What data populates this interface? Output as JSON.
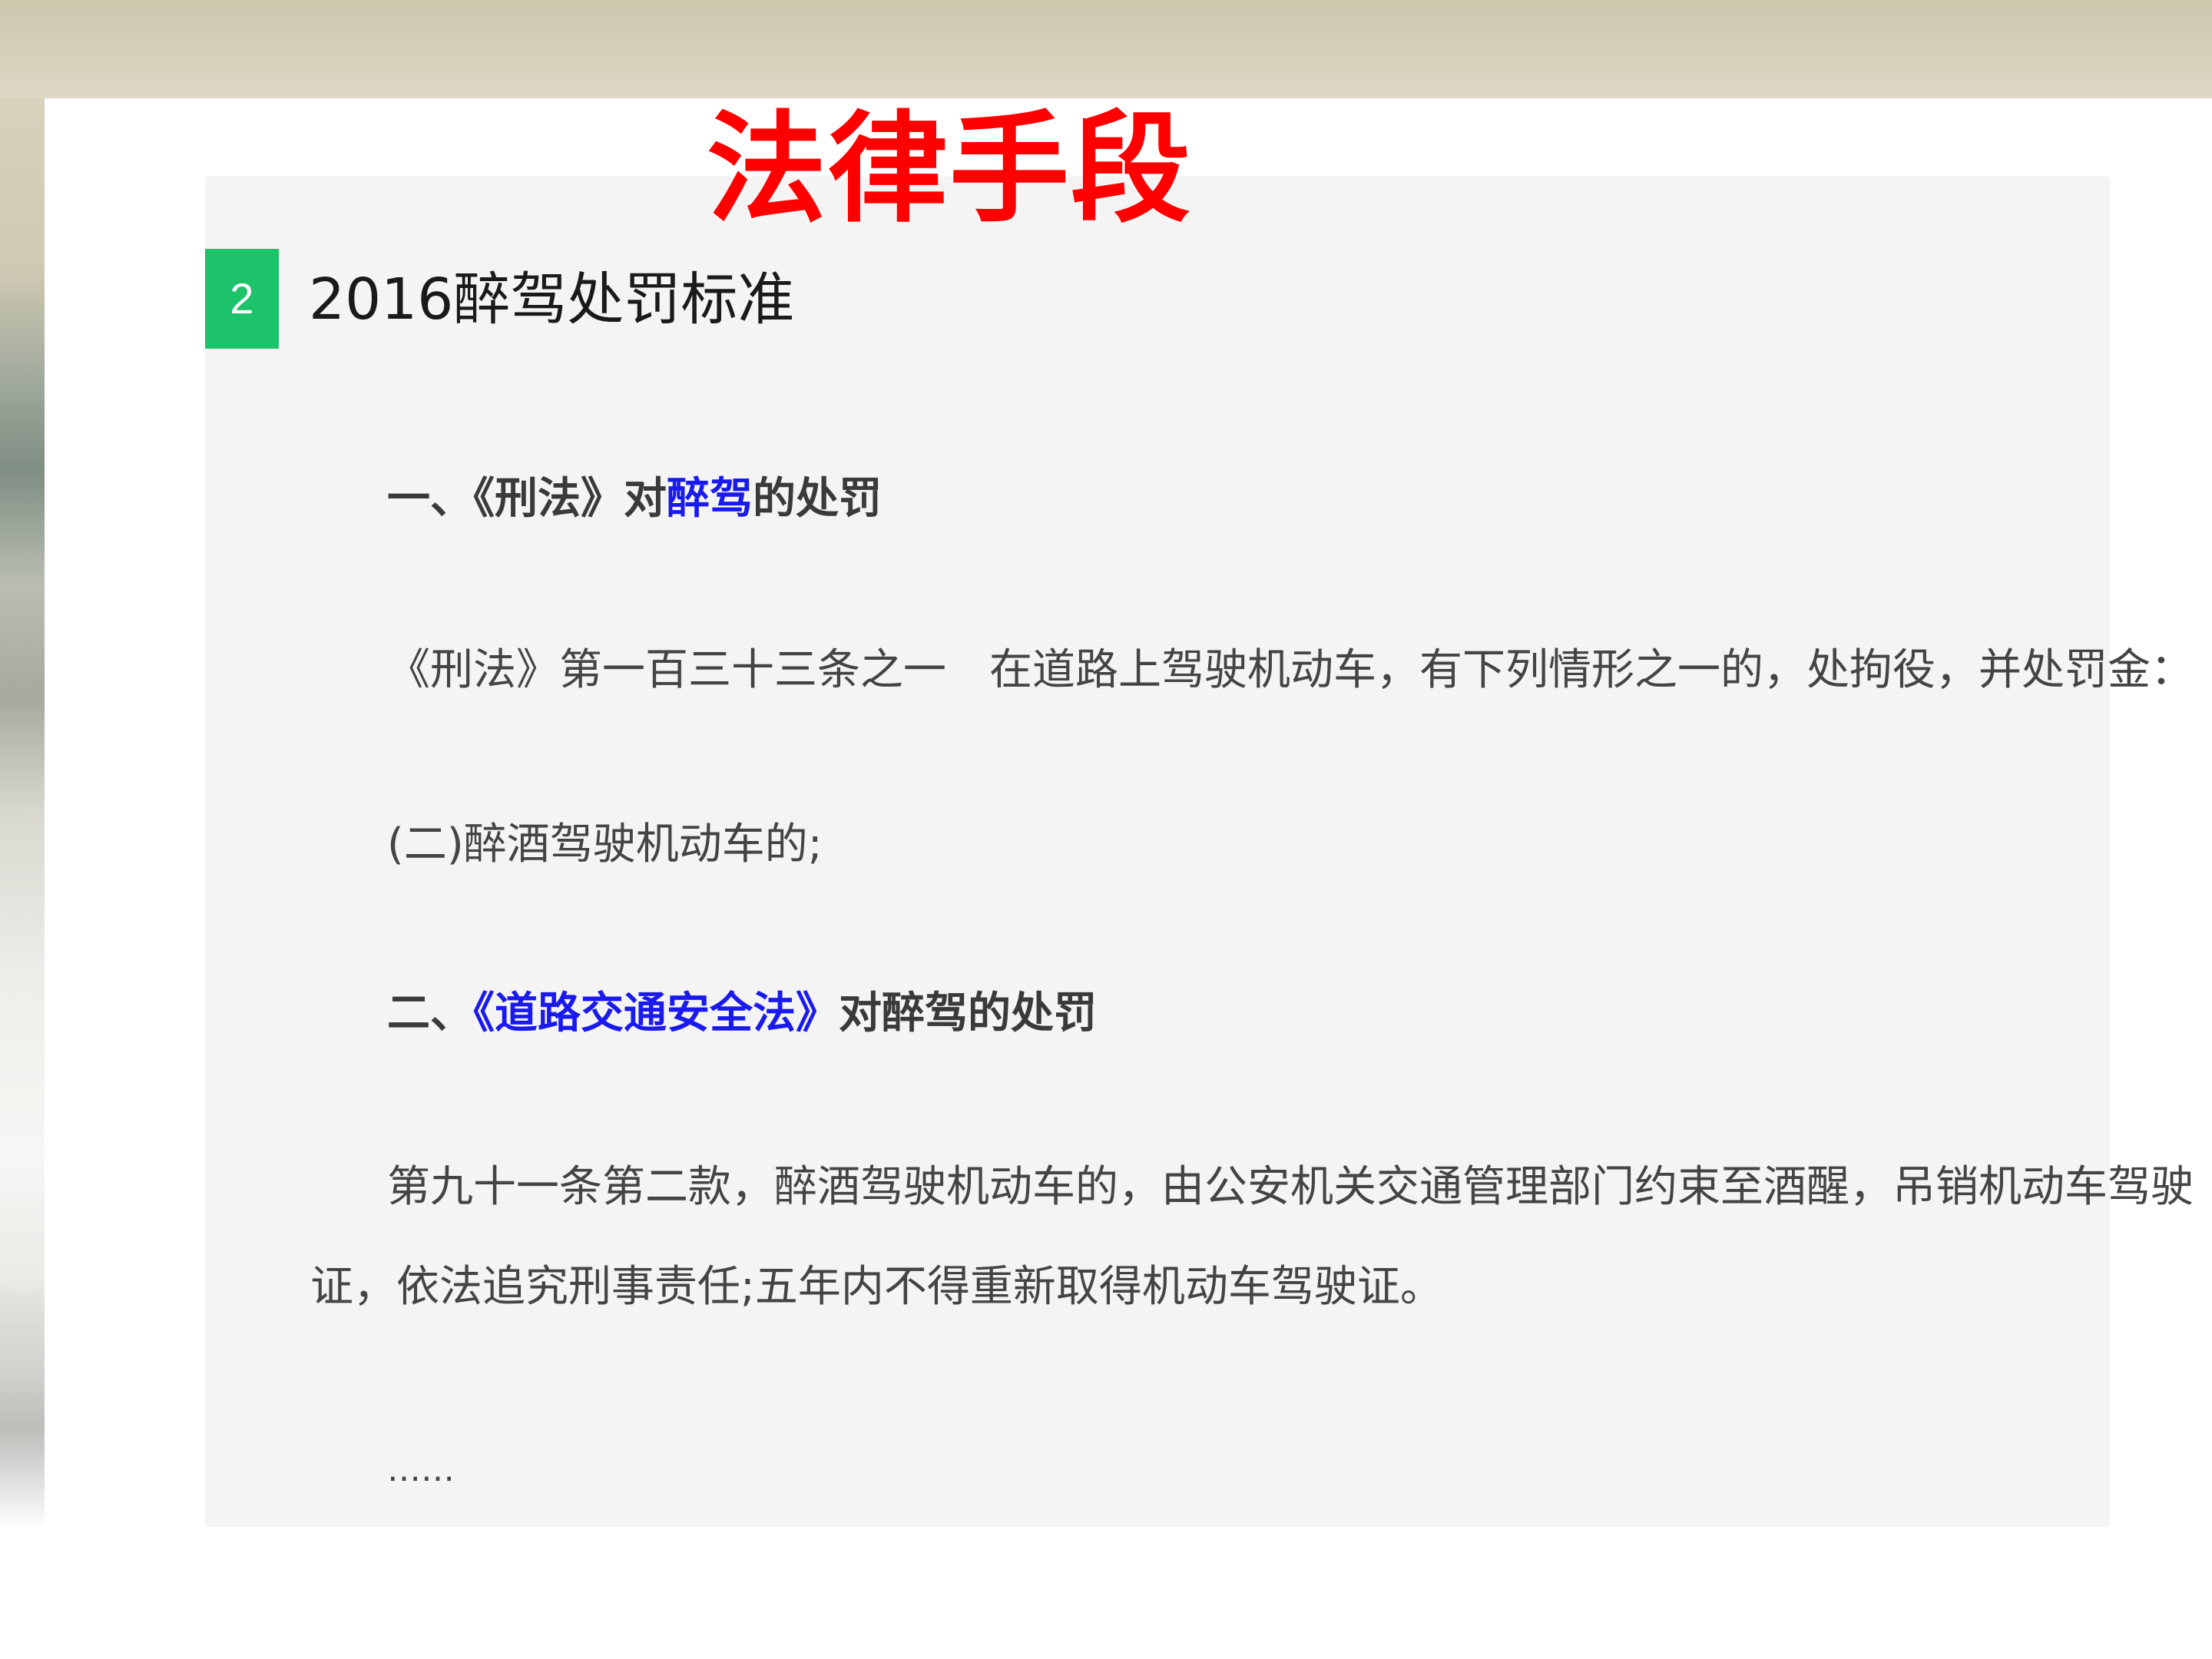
{
  "slide": {
    "title": "法律手段"
  },
  "article": {
    "step_number": "2",
    "step_heading": "2016醉驾处罚标准",
    "section1": {
      "prefix": "一、《刑法》对",
      "link": "醉驾",
      "suffix": "的处罚"
    },
    "para1": "《刑法》第一百三十三条之一　在道路上驾驶机动车，有下列情形之一的，处拘役，并处罚金：",
    "para2": "(二)醉酒驾驶机动车的;",
    "section2": {
      "prefix": "二、",
      "link": "《道路交通安全法》",
      "suffix": "对醉驾的处罚"
    },
    "para3_line1": "第九十一条第二款，醉酒驾驶机动车的，由公安机关交通管理部门约束至酒醒，吊销机动车驾驶",
    "para3_line2": "证，依法追究刑事责任;五年内不得重新取得机动车驾驶证。",
    "ellipsis": "……"
  },
  "colors": {
    "title_red": "#ff0000",
    "badge_green": "#1dc36a",
    "link_blue": "#1a1aee",
    "panel_grey": "#f4f4f4"
  }
}
